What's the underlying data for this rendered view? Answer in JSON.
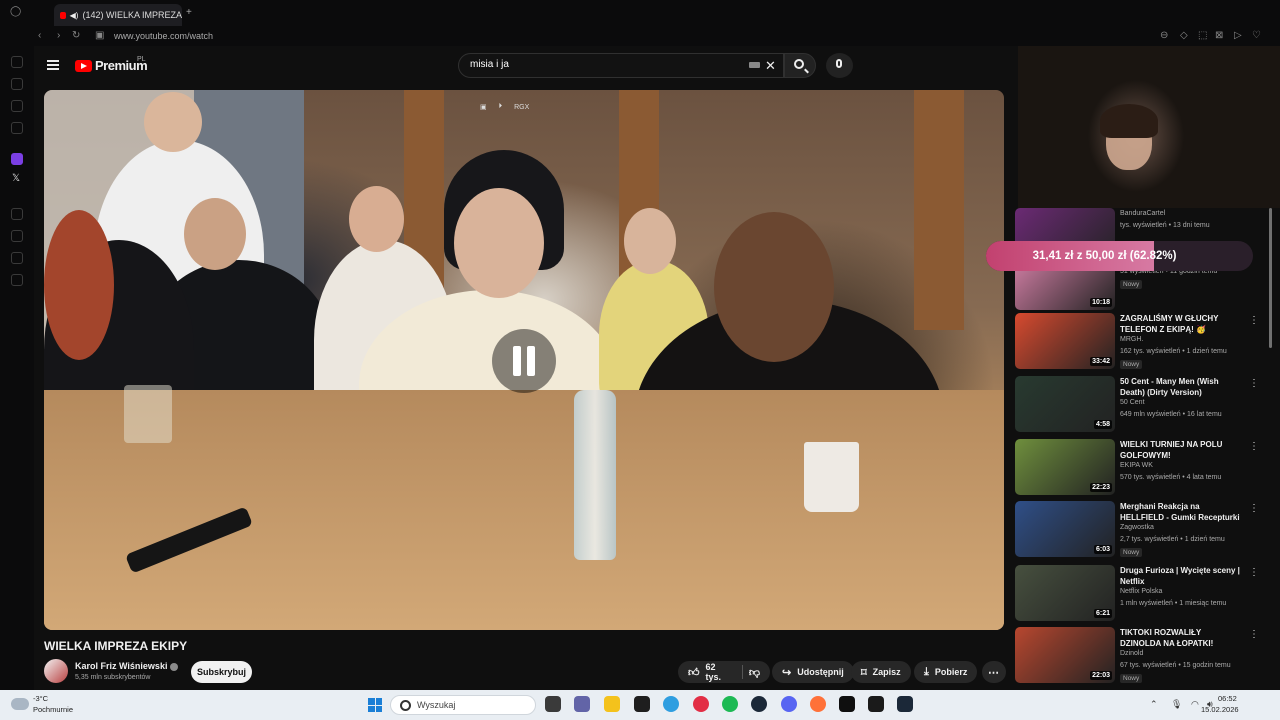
{
  "browser": {
    "tab_title": "(142) WIELKA IMPREZA",
    "url": "www.youtube.com/watch"
  },
  "header": {
    "logo_text": "Premium",
    "logo_country": "PL",
    "search_value": "misia i ja"
  },
  "video": {
    "overlay_label": "RGX",
    "title": "WIELKA IMPREZA EKIPY",
    "channel": "Karol Friz Wiśniewski",
    "subscribers": "5,35 mln subskrybentów",
    "subscribe_label": "Subskrybuj",
    "likes": "62 tys.",
    "share_label": "Udostępnij",
    "save_label": "Zapisz",
    "download_label": "Pobierz"
  },
  "donation": {
    "text": "31,41 zł z 50,00 zł (62.82%)",
    "progress_percent": 62.82,
    "accent": "#c2416f"
  },
  "recommendations": [
    {
      "title": "",
      "channel": "BanduraCartel",
      "meta": "tys. wyświetleń • 13 dni temu",
      "duration": "16:54",
      "badge": "",
      "thumb_color": "#6b2a74"
    },
    {
      "title": "",
      "channel": "Michu",
      "meta": "51 wyświetleń • 11 godzin temu",
      "duration": "10:18",
      "badge": "Nowy",
      "thumb_color": "#d681a8"
    },
    {
      "title": "ZAGRALIŚMY W GŁUCHY TELEFON Z EKIPĄ! 🥳",
      "channel": "MRGH.",
      "meta": "162 tys. wyświetleń • 1 dzień temu",
      "duration": "33:42",
      "badge": "Nowy",
      "thumb_color": "#d74a2f"
    },
    {
      "title": "50 Cent - Many Men (Wish Death) (Dirty Version)",
      "channel": "50 Cent",
      "meta": "649 mln wyświetleń • 16 lat temu",
      "duration": "4:58",
      "badge": "",
      "thumb_color": "#283a30"
    },
    {
      "title": "WIELKI TURNIEJ NA POLU GOLFOWYM!",
      "channel": "EKIPA WK",
      "meta": "570 tys. wyświetleń • 4 lata temu",
      "duration": "22:23",
      "badge": "",
      "thumb_color": "#6f8f3d"
    },
    {
      "title": "Merghani Reakcja na HELLFIELD - Gumki Recepturki",
      "channel": "Zagwostka",
      "meta": "2,7 tys. wyświetleń • 1 dzień temu",
      "duration": "6:03",
      "badge": "Nowy",
      "thumb_color": "#2f4f88"
    },
    {
      "title": "Druga Furioza | Wycięte sceny | Netflix",
      "channel": "Netflix Polska",
      "meta": "1 mln wyświetleń • 1 miesiąc temu",
      "duration": "6:21",
      "badge": "",
      "thumb_color": "#47503f"
    },
    {
      "title": "TIKTOKI ROZWALIŁY DZINOLDA NA ŁOPATKI!",
      "channel": "Dzinold",
      "meta": "67 tys. wyświetleń • 15 godzin temu",
      "duration": "22:03",
      "badge": "Nowy",
      "thumb_color": "#b8472f"
    }
  ],
  "taskbar": {
    "temperature": "-3°C",
    "weather": "Pochmurnie",
    "search_placeholder": "Wyszukaj",
    "time": "06:52",
    "date": "15.02.2026"
  },
  "colors": {
    "youtube_red": "#ff0000",
    "background": "#0f0f0f"
  }
}
